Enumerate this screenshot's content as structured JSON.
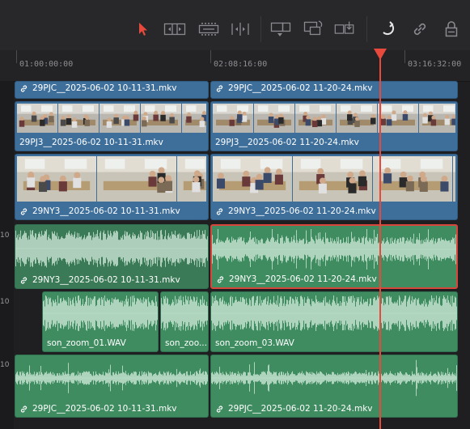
{
  "colors": {
    "video_clip": "#3e6f9b",
    "audio_clip": "#3f8c61",
    "playhead": "#e8493d",
    "selection": "#d8453a",
    "select_tool_active": "#e8493d"
  },
  "toolbar": {
    "tools": [
      {
        "name": "select-tool-icon",
        "active": true
      },
      {
        "name": "trim-tool-icon",
        "active": false
      },
      {
        "name": "dynamic-trim-icon",
        "active": false
      },
      {
        "name": "blade-tool-icon",
        "active": false
      },
      {
        "name": "insert-clip-icon",
        "active": false
      },
      {
        "name": "overwrite-clip-icon",
        "active": false
      },
      {
        "name": "replace-clip-icon",
        "active": false
      },
      {
        "name": "snapping-icon",
        "active": false
      },
      {
        "name": "linked-selection-icon",
        "active": false
      },
      {
        "name": "position-lock-icon",
        "active": false
      }
    ]
  },
  "ruler": {
    "timecodes": [
      "01:00:00:00",
      "02:08:16:00",
      "03:16:32:00"
    ]
  },
  "tracks": {
    "track_numbers": [
      "10",
      "10",
      "10"
    ]
  },
  "clips": {
    "v3_a": "29PJC__2025-06-02 10-11-31.mkv",
    "v3_b": "29PJC__2025-06-02 11-20-24.mkv",
    "v2_a": "29PJ3__2025-06-02 10-11-31.mkv",
    "v2_b": "29PJ3__2025-06-02 11-20-24.mkv",
    "v1_a": "29NY3__2025-06-02 10-11-31.mkv",
    "v1_b": "29NY3__2025-06-02 11-20-24.mkv",
    "a1_a": "29NY3__2025-06-02 10-11-31.mkv",
    "a1_b": "29NY3__2025-06-02 11-20-24.mkv",
    "a2_a": "son_zoom_01.WAV",
    "a2_b": "son_zoo...",
    "a2_c": "son_zoom_03.WAV",
    "a3_a": "29PJC__2025-06-02 10-11-31.mkv",
    "a3_b": "29PJC__2025-06-02 11-20-24.mkv"
  }
}
